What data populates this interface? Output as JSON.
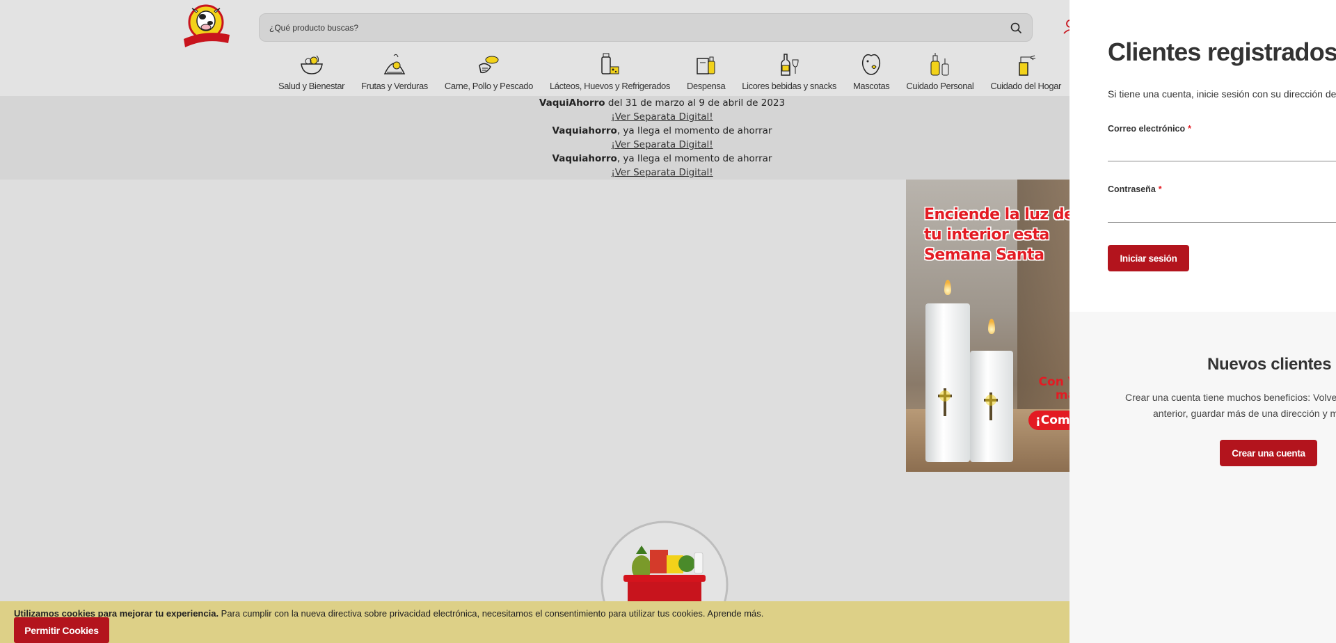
{
  "header": {
    "logo_text": "La Vaquita",
    "search": {
      "placeholder": "¿Qué producto buscas?"
    },
    "categories": [
      {
        "label": "Salud y Bienestar",
        "icon": "salad-bowl-icon"
      },
      {
        "label": "Frutas y Verduras",
        "icon": "fruit-basket-icon"
      },
      {
        "label": "Carne, Pollo y Pescado",
        "icon": "meat-fish-icon"
      },
      {
        "label": "Lácteos, Huevos y Refrigerados",
        "icon": "milk-cheese-icon"
      },
      {
        "label": "Despensa",
        "icon": "pantry-bag-icon"
      },
      {
        "label": "Licores bebidas y snacks",
        "icon": "bottle-glass-icon"
      },
      {
        "label": "Mascotas",
        "icon": "pet-dog-icon"
      },
      {
        "label": "Cuidado Personal",
        "icon": "personal-care-icon"
      },
      {
        "label": "Cuidado del Hogar",
        "icon": "spray-bottle-icon"
      }
    ]
  },
  "promo": {
    "lines": [
      {
        "bold": "VaquiAhorro",
        "text": " del 31 de marzo al 9 de abril de 2023",
        "link": "¡Ver Separata Digital!"
      },
      {
        "bold": "Vaquiahorro",
        "text": ", ya llega el momento de ahorrar",
        "link": "¡Ver Separata Digital!"
      },
      {
        "bold": "Vaquiahorro",
        "text": ", ya llega el momento de ahorrar",
        "link": "¡Ver Separata Digital!"
      }
    ]
  },
  "banner": {
    "headline": "Enciende la luz de tu interior esta Semana Santa",
    "side_text": "Con Velo marca",
    "button": "¡Comp"
  },
  "cookie": {
    "bold": "Utilizamos cookies para mejorar tu experiencia.",
    "text": " Para cumplir con la nueva directiva sobre privacidad electrónica, necesitamos el consentimiento para utilizar tus cookies.",
    "link": " Aprende más.",
    "button": "Permitir Cookies"
  },
  "login": {
    "title": "Clientes registrados",
    "subtitle": "Si tiene una cuenta, inicie sesión con su dirección de",
    "email_label": "Correo electrónico",
    "password_label": "Contraseña",
    "required_mark": "*",
    "submit": "Iniciar sesión"
  },
  "new_customers": {
    "title": "Nuevos clientes",
    "line1": "Crear una cuenta tiene muchos beneficios: Volve",
    "line2": "anterior, guardar más de una dirección y m",
    "button": "Crear una cuenta"
  },
  "colors": {
    "brand_red": "#b3141d",
    "banner_red": "#e31b23",
    "cookie_bg": "#ddd087",
    "icon_yellow": "#f2d21a"
  }
}
